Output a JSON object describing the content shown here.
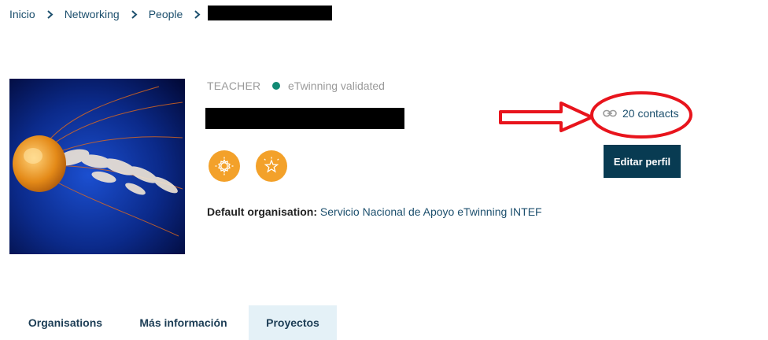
{
  "breadcrumb": {
    "items": [
      "Inicio",
      "Networking",
      "People"
    ]
  },
  "profile": {
    "role": "TEACHER",
    "validation_text": "eTwinning validated",
    "org_label": "Default organisation:",
    "org_name": "Servicio Nacional de Apoyo eTwinning INTEF",
    "contacts_label": "20 contacts",
    "edit_button": "Editar perfil",
    "badges": [
      "settings-badge-icon",
      "star-badge-icon"
    ]
  },
  "tabs": [
    "Organisations",
    "Más información",
    "Proyectos"
  ],
  "colors": {
    "link": "#1c4f6d",
    "validated_dot": "#118a74",
    "badge": "#f3a12a",
    "button": "#083b52",
    "active_tab_bg": "#e4f1f7",
    "annotation": "#e8141c"
  }
}
